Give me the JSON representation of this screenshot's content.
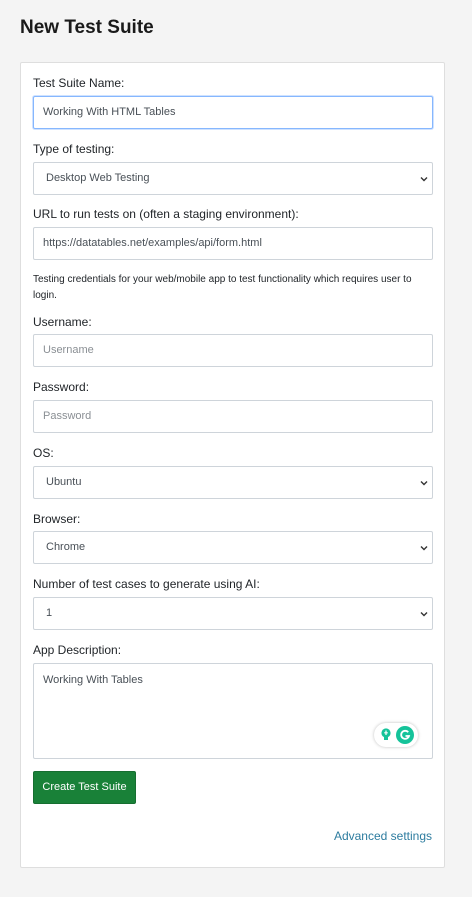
{
  "page": {
    "title": "New Test Suite"
  },
  "form": {
    "suite_name": {
      "label": "Test Suite Name:",
      "value": "Working With HTML Tables"
    },
    "testing_type": {
      "label": "Type of testing:",
      "value": "Desktop Web Testing"
    },
    "url": {
      "label": "URL to run tests on (often a staging environment):",
      "value": "https://datatables.net/examples/api/form.html"
    },
    "credentials_help": "Testing credentials for your web/mobile app to test functionality which requires user to login.",
    "username": {
      "label": "Username:",
      "placeholder": "Username"
    },
    "password": {
      "label": "Password:",
      "placeholder": "Password"
    },
    "os": {
      "label": "OS:",
      "value": "Ubuntu"
    },
    "browser": {
      "label": "Browser:",
      "value": "Chrome"
    },
    "num_cases": {
      "label": "Number of test cases to generate using AI:",
      "value": "1"
    },
    "app_description": {
      "label": "App Description:",
      "value": "Working With Tables"
    },
    "submit_label": "Create Test Suite",
    "advanced_label": "Advanced settings"
  },
  "colors": {
    "primary_button": "#198138",
    "link": "#2d7c9f",
    "focus_border": "#86b7fe",
    "grammarly": "#15c39a"
  },
  "icons": {
    "select_caret": "chevron-down-icon",
    "grammarly": "grammarly-icon",
    "suggestion": "lightbulb-icon"
  }
}
